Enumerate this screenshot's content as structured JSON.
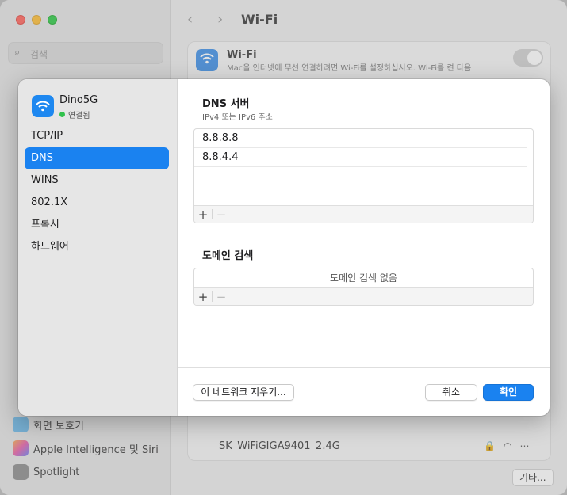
{
  "background": {
    "title": "Wi-Fi",
    "search_placeholder": "검색",
    "sidebar_items": [
      {
        "label": "화면 보호기"
      },
      {
        "label": "Apple Intelligence 및 Siri"
      },
      {
        "label": "Spotlight"
      }
    ],
    "wifi_card": {
      "title": "Wi-Fi",
      "description": "Mac을 인터넷에 무선 연결하려면 Wi-Fi를 설정하십시오. Wi-Fi를 켠 다음"
    },
    "networks": [
      {
        "name": "SK_WiFiGIGA9401_2.4G"
      }
    ],
    "other_button": "기타..."
  },
  "sheet": {
    "network": {
      "name": "Dino5G",
      "status": "연결됨"
    },
    "nav_items": [
      {
        "label": "TCP/IP",
        "active": false
      },
      {
        "label": "DNS",
        "active": true
      },
      {
        "label": "WINS",
        "active": false
      },
      {
        "label": "802.1X",
        "active": false
      },
      {
        "label": "프록시",
        "active": false
      },
      {
        "label": "하드웨어",
        "active": false
      }
    ],
    "dns": {
      "title": "DNS 서버",
      "subtitle": "IPv4 또는 IPv6 주소",
      "servers": [
        "8.8.8.8",
        "8.8.4.4"
      ],
      "add": "+",
      "remove": "−"
    },
    "domain": {
      "title": "도메인 검색",
      "empty": "도메인 검색 없음",
      "add": "+",
      "remove": "−"
    },
    "footer": {
      "forget": "이 네트워크 지우기...",
      "cancel": "취소",
      "ok": "확인"
    }
  },
  "colors": {
    "accent": "#1a82f0",
    "connected": "#32c24d"
  }
}
